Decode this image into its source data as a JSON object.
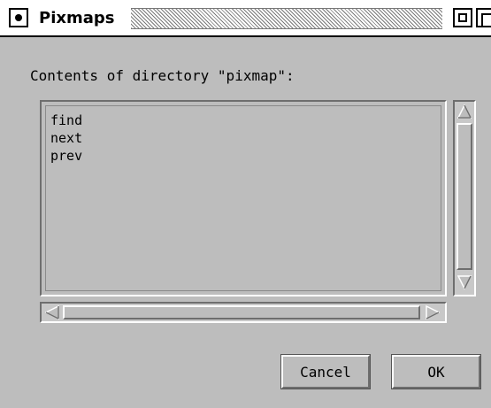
{
  "window": {
    "title": "Pixmaps",
    "close_icon": "close-box-icon",
    "zoom_icon": "zoom-box-icon",
    "grow_icon": "grow-box-icon"
  },
  "dialog": {
    "prompt": "Contents of directory \"pixmap\":",
    "files": [
      "find",
      "next",
      "prev"
    ],
    "cancel_label": "Cancel",
    "ok_label": "OK"
  }
}
